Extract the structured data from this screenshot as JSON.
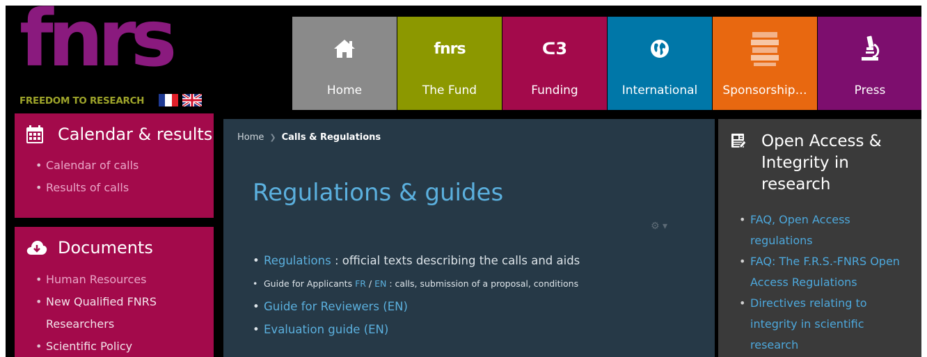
{
  "logo": {
    "word": "fnrs",
    "tagline": "FREEDOM TO RESEARCH"
  },
  "flags": {
    "fr": [
      "#1f3a93",
      "#ffffff",
      "#e2202a"
    ],
    "uk_bg": "#1d2f7a",
    "uk_red": "#d0122c"
  },
  "nav": [
    {
      "label": "Home",
      "icon": "home-icon",
      "color": "#8a8a8a"
    },
    {
      "label": "The Fund",
      "icon": "fnrs-logo-icon",
      "glyph": "fnrs",
      "color": "#8c9800"
    },
    {
      "label": "Funding",
      "icon": "funding-symbol-icon",
      "glyph": "ᑕ3",
      "color": "#a30a4b"
    },
    {
      "label": "International",
      "icon": "globe-icon",
      "color": "#0077a8"
    },
    {
      "label": "Sponsorship…",
      "icon": "numbers-pattern-icon",
      "color": "#e86810"
    },
    {
      "label": "Press",
      "icon": "microscope-icon",
      "color": "#7d0e6e"
    }
  ],
  "left": {
    "calendar": {
      "title": "Calendar & results",
      "items": [
        "Calendar of calls",
        "Results of calls"
      ]
    },
    "documents": {
      "title": "Documents",
      "items": [
        "Human Resources",
        "New Qualified FNRS Researchers",
        "Scientific Policy"
      ]
    }
  },
  "breadcrumb": {
    "home": "Home",
    "current": "Calls & Regulations"
  },
  "main": {
    "title": "Regulations & guides",
    "item1": {
      "link": "Regulations",
      "text": " : official texts describing the calls and aids"
    },
    "item2": {
      "prefix": "Guide for Applicants ",
      "fr": "FR",
      "slash": " / ",
      "en": "EN",
      "suffix": " : calls, submission of a proposal, conditions"
    },
    "item3": "Guide for Reviewers (EN)",
    "item4": "Evaluation guide (EN)"
  },
  "right": {
    "title": "Open Access & Integrity in research",
    "items": [
      "FAQ, Open Access regulations",
      "FAQ: The F.R.S.-FNRS Open Access Regulations",
      "Directives relating to integrity in scientific research"
    ]
  },
  "colors": {
    "brand_purple": "#8a1a7e",
    "brand_olive": "#9ea42a",
    "left_box": "#a30a4b",
    "main_bg": "#263947",
    "link": "#5bb0de",
    "right_box": "#3a3a3a"
  }
}
